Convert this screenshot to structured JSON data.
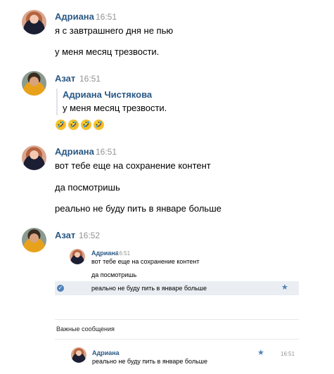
{
  "messages": [
    {
      "author": "Адриана",
      "time": "16:51",
      "lines": [
        "я с завтрашнего дня не пью",
        "у меня месяц трезвости."
      ]
    },
    {
      "author": "Азат",
      "time": "16:51",
      "quote": {
        "author": "Адриана Чистякова",
        "text": "у меня месяц трезвости."
      },
      "emoji": [
        "🤣",
        "🤣",
        "🤣",
        "🤣"
      ]
    },
    {
      "author": "Адриана",
      "time": "16:51",
      "lines": [
        "вот тебе еще на сохранение контент",
        "да посмотришь",
        "реально не буду пить в январе больше"
      ]
    },
    {
      "author": "Азат",
      "time": "16:52"
    }
  ],
  "forwarded": {
    "author": "Адриана",
    "time": "16:51",
    "lines": [
      "вот тебе еще на сохранение контент",
      "да посмотришь",
      "реально не буду пить в январе больше"
    ]
  },
  "important": {
    "title": "Важные сообщения",
    "author": "Адриана",
    "time": "16:51",
    "text": "реально не буду пить в январе больше"
  }
}
